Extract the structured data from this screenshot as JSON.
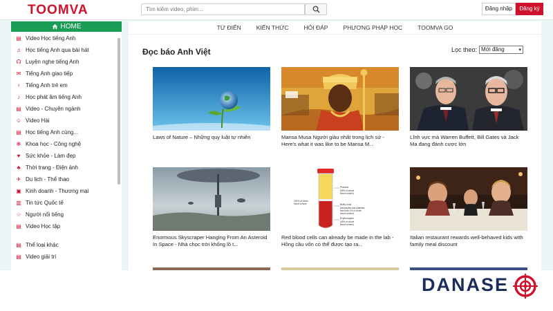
{
  "header": {
    "logo": "TOOMVA",
    "search_placeholder": "Tìm kiếm video, phim...",
    "login_label": "Đăng nhập",
    "register_label": "Đăng ký"
  },
  "sidebar": {
    "home_label": "HOME",
    "items": [
      {
        "label": "Video Học tiếng Anh",
        "icon": "film-icon"
      },
      {
        "label": "Học tiếng Anh qua bài hát",
        "icon": "music-icon"
      },
      {
        "label": "Luyện nghe tiếng Anh",
        "icon": "headphones-icon"
      },
      {
        "label": "Tiếng Anh giao tiếp",
        "icon": "chat-icon"
      },
      {
        "label": "Tiếng Anh trẻ em",
        "icon": "child-icon"
      },
      {
        "label": "Học phát âm tiếng Anh",
        "icon": "microphone-icon"
      },
      {
        "label": "Video - Chuyên ngành",
        "icon": "film-icon"
      },
      {
        "label": "Video Hài",
        "icon": "smile-icon"
      },
      {
        "label": "Học tiếng Anh cùng...",
        "icon": "film-icon"
      },
      {
        "label": "Khoa học - Công nghệ",
        "icon": "atom-icon"
      },
      {
        "label": "Sức khỏe - Làm đẹp",
        "icon": "heart-icon"
      },
      {
        "label": "Thời trang - Điện ảnh",
        "icon": "dress-icon"
      },
      {
        "label": "Du lịch - Thể thao",
        "icon": "plane-icon"
      },
      {
        "label": "Kinh doanh - Thương mại",
        "icon": "briefcase-icon"
      },
      {
        "label": "Tin tức Quốc tế",
        "icon": "news-icon"
      },
      {
        "label": "Người nổi tiếng",
        "icon": "star-icon"
      },
      {
        "label": "Video Học tập",
        "icon": "film-icon"
      }
    ],
    "extra_items": [
      {
        "label": "Thể loại khác",
        "icon": "film-icon"
      },
      {
        "label": "Video giải trí",
        "icon": "film-icon"
      }
    ]
  },
  "topnav": [
    "TỪ ĐIỂN",
    "KIẾN THỨC",
    "HỎI ĐÁP",
    "PHƯƠNG PHÁP HỌC",
    "TOOMVA GO"
  ],
  "main": {
    "title": "Đọc báo Anh Việt",
    "sort_label": "Lọc theo:",
    "sort_value": "Mới đăng"
  },
  "articles": [
    {
      "caption": "Laws of Nature – Những quy luật tự nhiên",
      "thumb": "globe-sprout"
    },
    {
      "caption": "Mansa Musa Người giàu nhất trong lịch sử - Here's what it was like to be Mansa M...",
      "thumb": "mansa-musa-painting"
    },
    {
      "caption": "Lĩnh vực mà Warren Buffett, Bill Gates và Jack Ma đang đánh cược lớn",
      "thumb": "two-businessmen"
    },
    {
      "caption": "Enormous Skyscraper Hanging From An Asteroid In Space - Nhà chọc trời khổng lồ t...",
      "thumb": "hanging-skyscraper"
    },
    {
      "caption": "Red blood cells can already be made in the lab - Hồng cầu vốn có thể được tạo ra...",
      "thumb": "blood-test-tube"
    },
    {
      "caption": "Italian restaurant rewards well-behaved kids with family meal discount",
      "thumb": "restaurant-kids"
    }
  ],
  "tube_labels": {
    "plasma": "Plasma",
    "plasma_pct": "(55% of whole",
    "plasma_pct2": "blood volume)",
    "whole": "100% of whole",
    "whole2": "blood volume",
    "buffy": "Buffy coat",
    "buffy2": "(leukocytes and platelets;",
    "buffy3": "less than 1% of whole",
    "buffy4": "blood volume)",
    "ery": "Erythrocytes",
    "ery2": "(45% of whole",
    "ery3": "blood volume)"
  },
  "watermark": "DANASE",
  "colors": {
    "brand_red": "#d0112b",
    "home_green": "#1a9e56",
    "page_bg": "#e9f5f6",
    "watermark_navy": "#1b2e5b"
  }
}
